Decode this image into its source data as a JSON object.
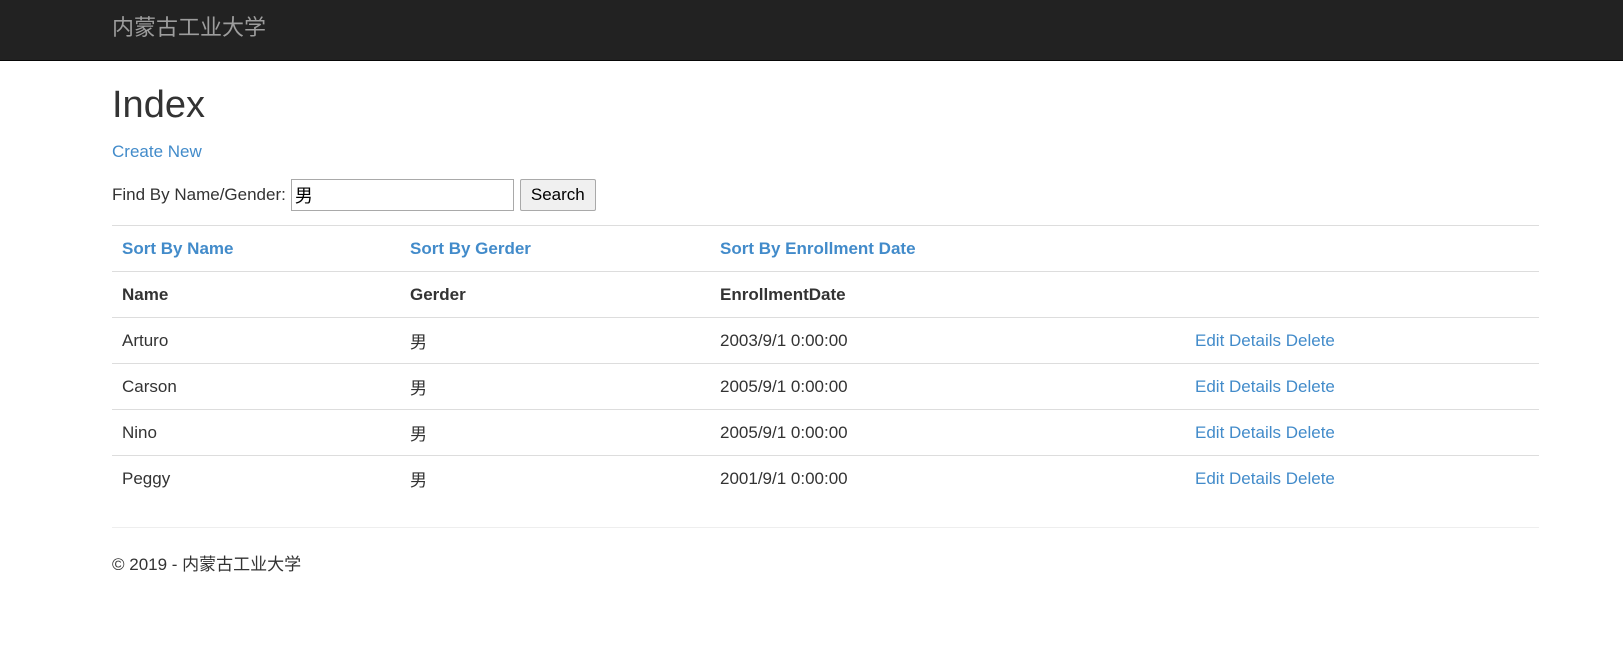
{
  "navbar": {
    "brand": "内蒙古工业大学"
  },
  "page": {
    "title": "Index",
    "create_link": "Create New"
  },
  "search": {
    "label": "Find By Name/Gender:",
    "value": "男",
    "button": "Search"
  },
  "table": {
    "sort_links": {
      "name": "Sort By Name",
      "gender": "Sort By Gerder",
      "date": "Sort By Enrollment Date"
    },
    "headers": {
      "name": "Name",
      "gender": "Gerder",
      "date": "EnrollmentDate"
    },
    "actions": {
      "edit": "Edit",
      "details": "Details",
      "delete": "Delete"
    },
    "rows": [
      {
        "name": "Arturo",
        "gender": "男",
        "date": "2003/9/1 0:00:00"
      },
      {
        "name": "Carson",
        "gender": "男",
        "date": "2005/9/1 0:00:00"
      },
      {
        "name": "Nino",
        "gender": "男",
        "date": "2005/9/1 0:00:00"
      },
      {
        "name": "Peggy",
        "gender": "男",
        "date": "2001/9/1 0:00:00"
      }
    ]
  },
  "footer": {
    "text": "© 2019 - 内蒙古工业大学"
  },
  "colors": {
    "navbar_bg": "#222222",
    "brand_text": "#9d9d9d",
    "link": "#428bca",
    "text": "#333333",
    "border": "#dddddd"
  }
}
